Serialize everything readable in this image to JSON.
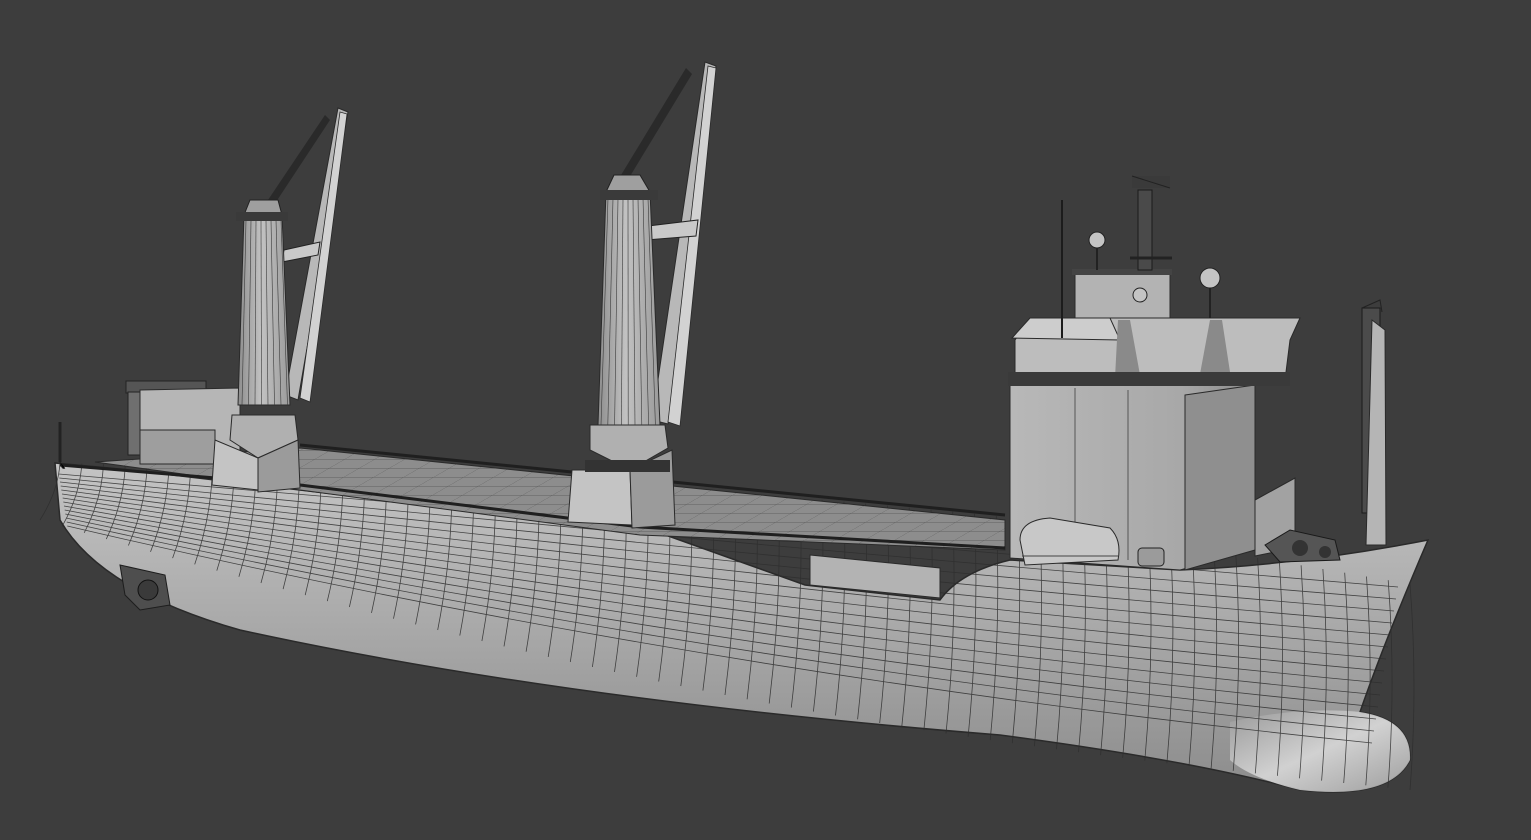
{
  "scene": {
    "background_color": "#3d3d3d",
    "model_fill": "#a9a9a9",
    "model_fill_light": "#c9c9c9",
    "model_fill_dark": "#7f7f7f",
    "wire_color": "#2a2a2a"
  }
}
